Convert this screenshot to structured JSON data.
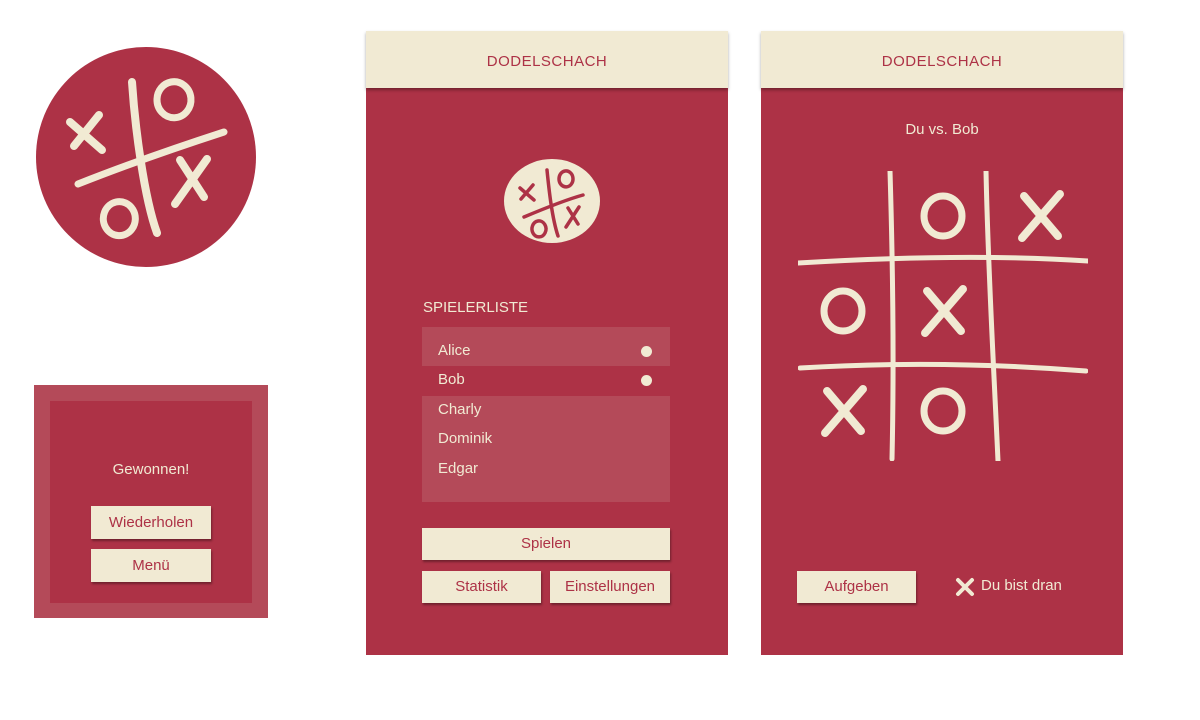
{
  "colors": {
    "brand_red": "#ad3246",
    "cream": "#f1ead3",
    "light_red": "#b44a59"
  },
  "logo": {
    "icon": "tic-tac-toe-logo-icon"
  },
  "dialog": {
    "title": "Gewonnen!",
    "repeat_label": "Wiederholen",
    "menu_label": "Menü"
  },
  "lobby": {
    "app_title": "DODELSCHACH",
    "list_heading": "SPIELERLISTE",
    "players": [
      {
        "name": "Alice",
        "online": true,
        "selected": true
      },
      {
        "name": "Bob",
        "online": true,
        "selected": false
      },
      {
        "name": "Charly",
        "online": false,
        "selected": true
      },
      {
        "name": "Dominik",
        "online": false,
        "selected": true
      },
      {
        "name": "Edgar",
        "online": false,
        "selected": true
      }
    ],
    "play_label": "Spielen",
    "stats_label": "Statistik",
    "settings_label": "Einstellungen"
  },
  "game": {
    "app_title": "DODELSCHACH",
    "matchup": "Du vs. Bob",
    "board": [
      "",
      "O",
      "X",
      "O",
      "X",
      "",
      "X",
      "O",
      ""
    ],
    "give_up_label": "Aufgeben",
    "turn_icon": "x-mark-icon",
    "turn_status": "Du bist dran"
  }
}
